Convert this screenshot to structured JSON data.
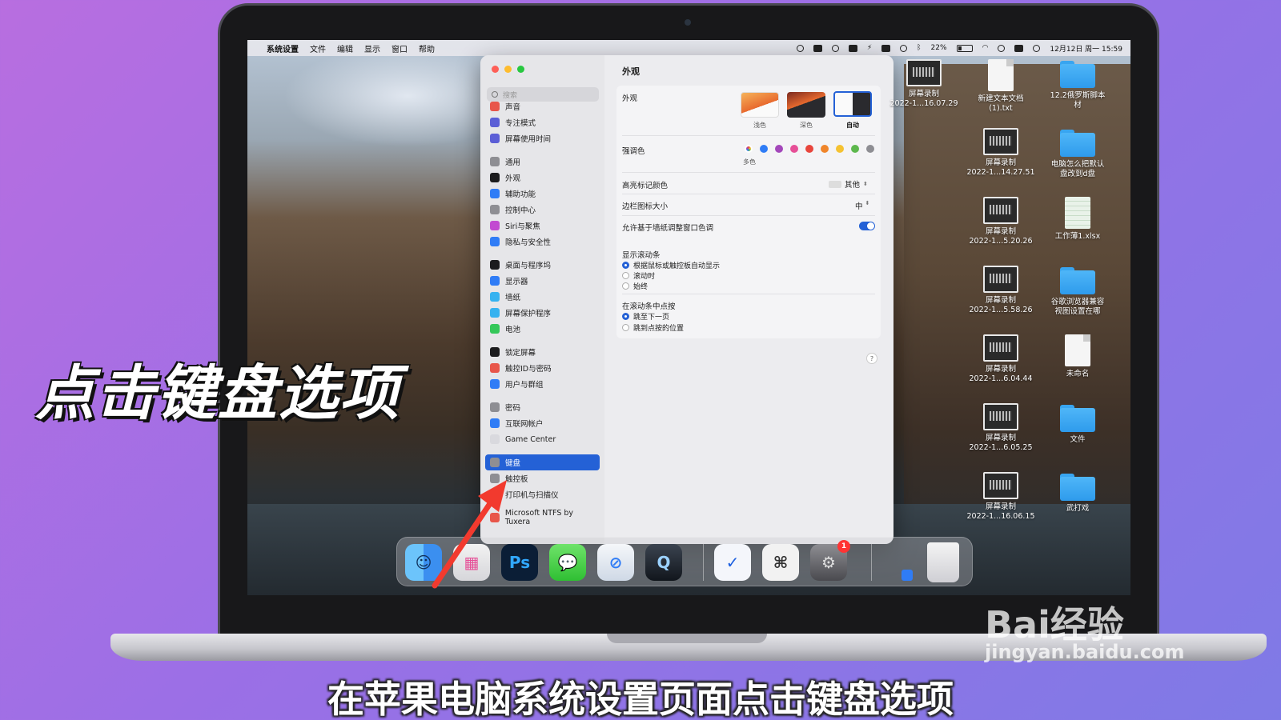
{
  "menubar": {
    "app": "系统设置",
    "items": [
      "文件",
      "编辑",
      "显示",
      "窗口",
      "帮助"
    ],
    "battery": "22%",
    "datetime": "12月12日 周一 15:59"
  },
  "sidebar": {
    "search_placeholder": "搜索",
    "groups": [
      [
        {
          "label": "声音",
          "color": "#e8564a"
        },
        {
          "label": "专注模式",
          "color": "#5b5ed6"
        },
        {
          "label": "屏幕使用时间",
          "color": "#5b5ed6"
        }
      ],
      [
        {
          "label": "通用",
          "color": "#8e8e93"
        },
        {
          "label": "外观",
          "color": "#1c1c1e"
        },
        {
          "label": "辅助功能",
          "color": "#2f7cf6"
        },
        {
          "label": "控制中心",
          "color": "#8e8e93"
        },
        {
          "label": "Siri与聚焦",
          "color": "#c24ad1"
        },
        {
          "label": "隐私与安全性",
          "color": "#2f7cf6"
        }
      ],
      [
        {
          "label": "桌面与程序坞",
          "color": "#1c1c1e"
        },
        {
          "label": "显示器",
          "color": "#2f7cf6"
        },
        {
          "label": "墙纸",
          "color": "#36b2f0"
        },
        {
          "label": "屏幕保护程序",
          "color": "#36b2f0"
        },
        {
          "label": "电池",
          "color": "#34c759"
        }
      ],
      [
        {
          "label": "锁定屏幕",
          "color": "#1c1c1e"
        },
        {
          "label": "触控ID与密码",
          "color": "#e8564a"
        },
        {
          "label": "用户与群组",
          "color": "#2f7cf6"
        }
      ],
      [
        {
          "label": "密码",
          "color": "#8e8e93"
        },
        {
          "label": "互联网帐户",
          "color": "#2f7cf6"
        },
        {
          "label": "Game Center",
          "color": "#d9d9de"
        }
      ],
      [
        {
          "label": "键盘",
          "color": "#8e8e93",
          "active": true
        },
        {
          "label": "触控板",
          "color": "#8e8e93"
        },
        {
          "label": "打印机与扫描仪",
          "color": "#8e8e93"
        }
      ],
      [
        {
          "label": "Microsoft NTFS by Tuxera",
          "color": "#e8564a"
        }
      ]
    ]
  },
  "main": {
    "title": "外观",
    "appearance_label": "外观",
    "appearance_options": [
      "浅色",
      "深色",
      "自动"
    ],
    "accent_label": "强调色",
    "accent_colors": [
      "#a05ad6",
      "#2f7cf6",
      "#a347ba",
      "#e64f97",
      "#e8453c",
      "#f0852a",
      "#f5c231",
      "#5db84d",
      "#8e8e93"
    ],
    "accent_multicolor_label": "多色",
    "highlight_label": "高亮标记颜色",
    "highlight_value": "其他",
    "sidebar_icon_label": "边栏图标大小",
    "sidebar_icon_value": "中",
    "tint_label": "允许基于墙纸调整窗口色调",
    "scrollbars_label": "显示滚动条",
    "scrollbars_options": [
      "根据鼠标或触控板自动显示",
      "滚动时",
      "始终"
    ],
    "click_label": "在滚动条中点按",
    "click_options": [
      "跳至下一页",
      "跳到点按的位置"
    ],
    "help": "?"
  },
  "desktop": {
    "icons": [
      {
        "label": "屏幕录制\n2022-1...16.07.29",
        "kind": "shot"
      },
      {
        "label": "新建文本文档\n(1).txt",
        "kind": "doc"
      },
      {
        "label": "12.2俄罗斯脚本\n材",
        "kind": "folder"
      },
      {
        "label": "屏幕录制\n2022-1...14.27.51",
        "kind": "shot"
      },
      {
        "label": "电脑怎么把默认\n盘改到d盘",
        "kind": "folder"
      },
      {
        "label": "屏幕录制\n2022-1...5.20.26",
        "kind": "shot"
      },
      {
        "label": "工作薄1.xlsx",
        "kind": "xls"
      },
      {
        "label": "屏幕录制\n2022-1...5.58.26",
        "kind": "shot"
      },
      {
        "label": "谷歌浏览器兼容\n视图设置在哪",
        "kind": "folder"
      },
      {
        "label": "屏幕录制\n2022-1...6.04.44",
        "kind": "shot"
      },
      {
        "label": "未命名",
        "kind": "doc"
      },
      {
        "label": "屏幕录制\n2022-1...6.05.25",
        "kind": "shot"
      },
      {
        "label": "文件",
        "kind": "folder"
      },
      {
        "label": "屏幕录制\n2022-1...16.06.15",
        "kind": "shot"
      },
      {
        "label": "武打戏",
        "kind": "folder"
      }
    ]
  },
  "dock": {
    "apps": [
      {
        "name": "finder",
        "glyph": "☺"
      },
      {
        "name": "launchpad",
        "glyph": "▦"
      },
      {
        "name": "photoshop",
        "glyph": "Ps"
      },
      {
        "name": "messages",
        "glyph": "💬"
      },
      {
        "name": "safari",
        "glyph": "⊘"
      },
      {
        "name": "quicktime",
        "glyph": "Q"
      },
      {
        "name": "lark",
        "glyph": "✓"
      },
      {
        "name": "preview",
        "glyph": "⌘"
      },
      {
        "name": "system-settings",
        "glyph": "⚙",
        "badge": "1"
      }
    ]
  },
  "overlay": {
    "caption": "点击键盘选项",
    "subtitle": "在苹果电脑系统设置页面点击键盘选项",
    "watermark": "Bai经验",
    "watermark_url": "jingyan.baidu.com"
  }
}
